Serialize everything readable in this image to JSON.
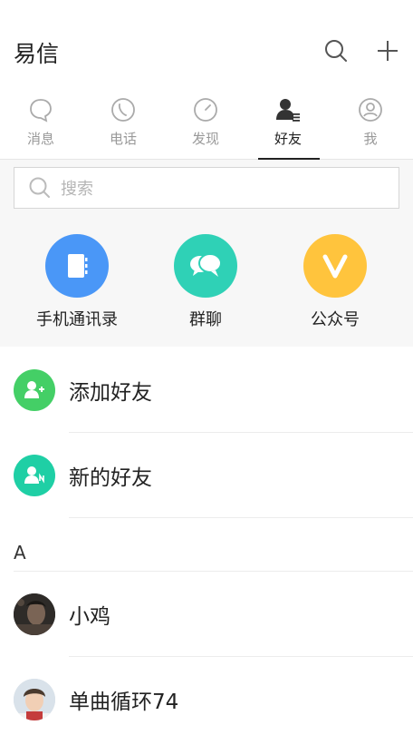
{
  "header": {
    "title": "易信"
  },
  "tabs": [
    {
      "label": "消息",
      "icon": "chat-bubble-icon",
      "active": false
    },
    {
      "label": "电话",
      "icon": "phone-icon",
      "active": false
    },
    {
      "label": "发现",
      "icon": "compass-icon",
      "active": false
    },
    {
      "label": "好友",
      "icon": "contacts-icon",
      "active": true
    },
    {
      "label": "我",
      "icon": "profile-icon",
      "active": false
    }
  ],
  "search": {
    "placeholder": "搜索"
  },
  "shortcuts": [
    {
      "label": "手机通讯录",
      "icon": "address-book-icon",
      "color": "#4a97f7"
    },
    {
      "label": "群聊",
      "icon": "group-chat-icon",
      "color": "#2fd1b6"
    },
    {
      "label": "公众号",
      "icon": "v-badge-icon",
      "color": "#ffc43d"
    }
  ],
  "actions": [
    {
      "label": "添加好友",
      "icon": "add-friend-icon",
      "color": "#44cf66"
    },
    {
      "label": "新的好友",
      "icon": "new-friend-icon",
      "color": "#1fcfa5"
    }
  ],
  "section": {
    "letter": "A"
  },
  "contacts": [
    {
      "name": "小鸡"
    },
    {
      "name": "单曲循环74"
    }
  ],
  "colors": {
    "inactive_text": "#999999",
    "active_text": "#222222",
    "background_gray": "#f7f7f7"
  }
}
